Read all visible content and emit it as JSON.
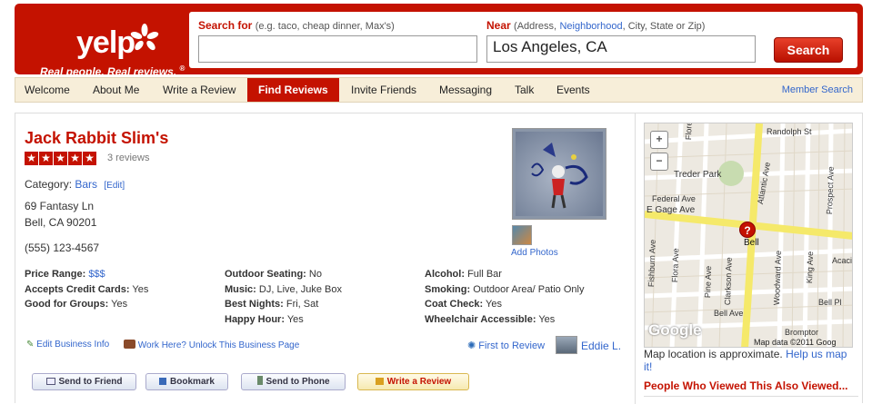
{
  "header": {
    "logo_text": "yelp",
    "tagline": "Real people. Real reviews.",
    "tagline_mark": "®",
    "search_for_label": "Search for",
    "search_for_hint": "(e.g. taco, cheap dinner, Max's)",
    "search_for_value": "",
    "near_label": "Near",
    "near_hint_1": "(Address,",
    "near_hint_link": "Neighborhood",
    "near_hint_2": ", City, State or Zip)",
    "near_value": "Los Angeles, CA",
    "search_button": "Search"
  },
  "nav": {
    "items": [
      "Welcome",
      "About Me",
      "Write a Review",
      "Find Reviews",
      "Invite Friends",
      "Messaging",
      "Talk",
      "Events"
    ],
    "active": "Find Reviews",
    "member_search": "Member Search"
  },
  "business": {
    "name": "Jack Rabbit Slim's",
    "rating": 5,
    "reviews": "3 reviews",
    "category_label": "Category:",
    "category": "Bars",
    "edit": "[Edit]",
    "address_line1": "69 Fantasy Ln",
    "address_line2": "Bell, CA 90201",
    "phone": "(555) 123-4567",
    "attributes": [
      {
        "label": "Price Range:",
        "value": "$$$"
      },
      {
        "label": "Accepts Credit Cards:",
        "value": "Yes"
      },
      {
        "label": "Good for Groups:",
        "value": "Yes"
      },
      {
        "label": "Outdoor Seating:",
        "value": "No"
      },
      {
        "label": "Music:",
        "value": "DJ, Live, Juke Box"
      },
      {
        "label": "Best Nights:",
        "value": "Fri, Sat"
      },
      {
        "label": "Happy Hour:",
        "value": "Yes"
      },
      {
        "label": "Alcohol:",
        "value": "Full Bar"
      },
      {
        "label": "Smoking:",
        "value": "Outdoor Area/ Patio Only"
      },
      {
        "label": "Coat Check:",
        "value": "Yes"
      },
      {
        "label": "Wheelchair Accessible:",
        "value": "Yes"
      }
    ],
    "add_photos": "Add Photos",
    "edit_business": "Edit Business Info",
    "work_here": "Work Here? Unlock This Business Page",
    "first_to_review": "First to Review",
    "reviewer": "Eddie L.",
    "buttons": {
      "send_friend": "Send to Friend",
      "bookmark": "Bookmark",
      "send_phone": "Send to Phone",
      "write_review": "Write a Review"
    }
  },
  "map": {
    "streets": [
      "Randolph St",
      "Florence Ave",
      "Treder Park",
      "Federal Ave",
      "E Gage Ave",
      "Atlantic Ave",
      "Prospect Ave",
      "Fishburn Ave",
      "Flora Ave",
      "Pine Ave",
      "Clarkson Ave",
      "Woodward Ave",
      "King Ave",
      "Acacia",
      "Bell Ave",
      "Bell Pl",
      "Bromptor"
    ],
    "marker_label": "Bell",
    "marker_symbol": "?",
    "attribution": "Map data ©2011 Goog",
    "google": "Google",
    "zoom_in": "+",
    "zoom_out": "−",
    "note_text": "Map location is approximate.",
    "note_link": "Help us map it!"
  },
  "also_viewed": "People Who Viewed This Also Viewed..."
}
